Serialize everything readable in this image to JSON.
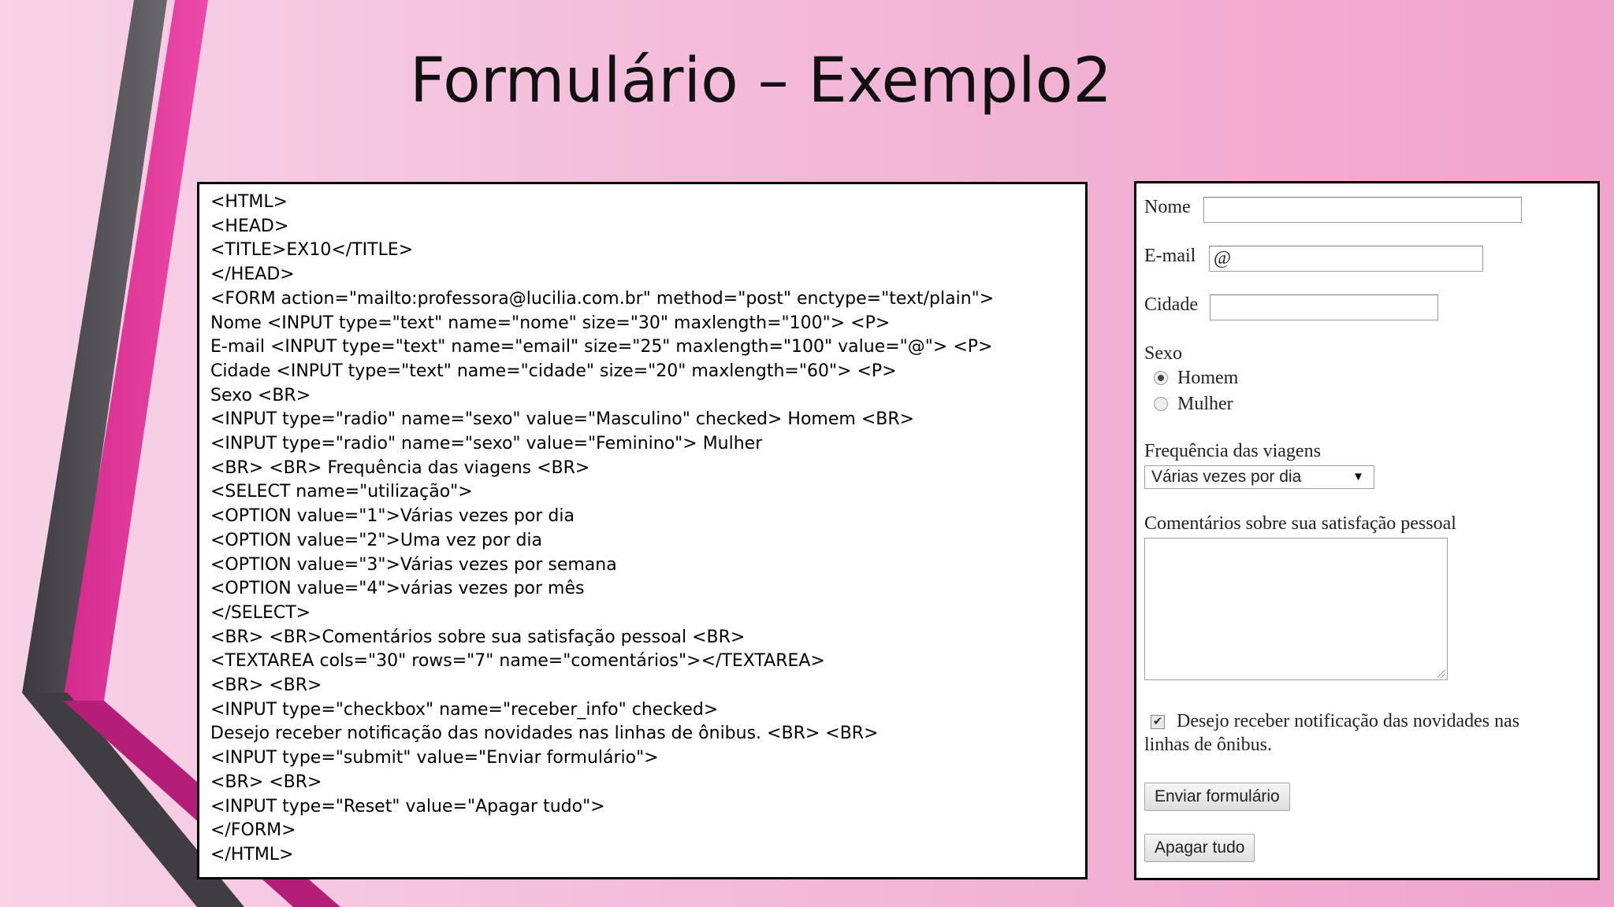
{
  "slide": {
    "title": "Formulário – Exemplo2"
  },
  "code_lines": [
    "<HTML>",
    "<HEAD>",
    "<TITLE>EX10</TITLE>",
    "</HEAD>",
    "<FORM action=\"mailto:professora@lucilia.com.br\" method=\"post\" enctype=\"text/plain\">",
    "Nome <INPUT type=\"text\" name=\"nome\" size=\"30\" maxlength=\"100\"> <P>",
    "E-mail <INPUT type=\"text\" name=\"email\" size=\"25\" maxlength=\"100\" value=\"@\"> <P>",
    "Cidade <INPUT type=\"text\" name=\"cidade\" size=\"20\" maxlength=\"60\"> <P>",
    "Sexo <BR>",
    "<INPUT type=\"radio\" name=\"sexo\" value=\"Masculino\" checked> Homem <BR>",
    "<INPUT type=\"radio\" name=\"sexo\" value=\"Feminino\"> Mulher",
    "<BR> <BR> Frequência das viagens <BR>",
    "<SELECT name=\"utilização\">",
    "<OPTION value=\"1\">Várias vezes por dia",
    "<OPTION value=\"2\">Uma vez por dia",
    "<OPTION value=\"3\">Várias vezes por semana",
    "<OPTION value=\"4\">várias vezes por mês",
    "</SELECT>",
    "<BR> <BR>Comentários sobre sua satisfação pessoal <BR>",
    "<TEXTAREA cols=\"30\" rows=\"7\" name=\"comentários\"></TEXTAREA>",
    "<BR> <BR>",
    "<INPUT type=\"checkbox\" name=\"receber_info\" checked>",
    "Desejo receber notificação das novidades nas linhas de ônibus. <BR> <BR>",
    "<INPUT type=\"submit\" value=\"Enviar formulário\">",
    "<BR> <BR>",
    "<INPUT type=\"Reset\" value=\"Apagar tudo\">",
    "</FORM>",
    "</HTML>"
  ],
  "form": {
    "nome_label": "Nome",
    "nome_value": "",
    "email_label": "E-mail",
    "email_value": "@",
    "cidade_label": "Cidade",
    "cidade_value": "",
    "sexo_label": "Sexo",
    "radio_homem": "Homem",
    "radio_mulher": "Mulher",
    "frequencia_label": "Frequência das viagens",
    "select_value": "Várias vezes por dia",
    "comentarios_label": "Comentários sobre sua satisfação pessoal",
    "checkbox_text_line1": "Desejo receber notificação das novidades nas",
    "checkbox_text_line2": "linhas de ônibus.",
    "submit_label": "Enviar formulário",
    "reset_label": "Apagar tudo"
  },
  "colors": {
    "background_light": "#f7d3e6",
    "background_dark": "#f0a3cb",
    "stripe_gray": "#58565a",
    "stripe_magenta": "#e0359a",
    "stripe_dark_magenta": "#b81e7a"
  }
}
